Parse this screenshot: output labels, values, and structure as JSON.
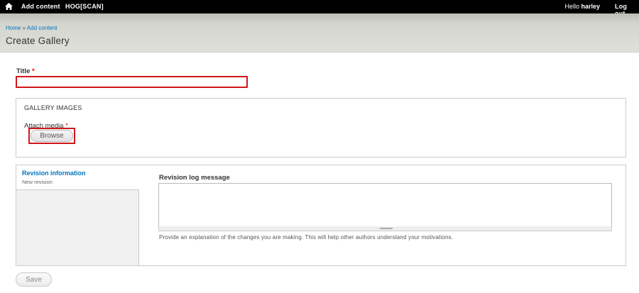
{
  "toolbar": {
    "home_icon": "home-icon",
    "add_content": "Add content",
    "hog_scan": "HOG[SCAN]",
    "hello_prefix": "Hello ",
    "username": "harley",
    "log_out": "Log out"
  },
  "breadcrumb": {
    "home": "Home",
    "separator": " » ",
    "add_content": "Add content"
  },
  "page_title": "Create Gallery",
  "title_field": {
    "label": "Title",
    "required_marker": "*",
    "value": "",
    "error_color": "#d0161b"
  },
  "gallery": {
    "legend": "GALLERY IMAGES",
    "attach_label": "Attach media",
    "required_marker": "*",
    "browse_label": "Browse"
  },
  "revision": {
    "tab_title": "Revision information",
    "tab_summary": "New revision",
    "log_label": "Revision log message",
    "log_value": "",
    "description": "Provide an explanation of the changes you are making. This will help other authors understand your motivations."
  },
  "actions": {
    "save_label": "Save"
  },
  "colors": {
    "link": "#0074bd",
    "required": "#ee0000",
    "toolbar_bg": "#000000"
  }
}
